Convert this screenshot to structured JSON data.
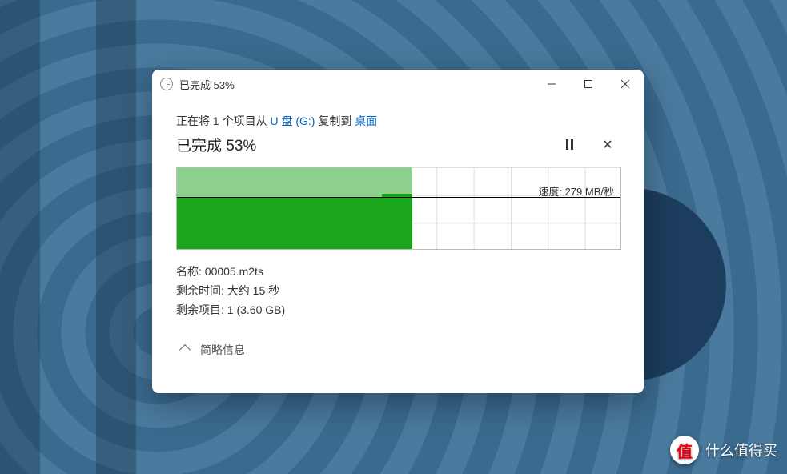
{
  "titlebar": {
    "title": "已完成 53%"
  },
  "copy": {
    "prefix": "正在将 1 个项目从 ",
    "source": "U 盘 (G:)",
    "middle": "复制到 ",
    "destination": "桌面"
  },
  "progress": {
    "title": "已完成 53%"
  },
  "chart_data": {
    "type": "area",
    "x": [
      0,
      10,
      20,
      30,
      40,
      53
    ],
    "values": [
      280,
      278,
      282,
      279,
      281,
      279
    ],
    "ylim": [
      0,
      430
    ],
    "ylabel": "速度 (MB/秒)",
    "progress_percent": 53,
    "current_speed": 279,
    "grid_cols": 12,
    "grid_rows": 3
  },
  "speed": {
    "label": "速度: ",
    "value": "279 MB/秒"
  },
  "details": {
    "name_label": "名称: ",
    "name_value": "00005.m2ts",
    "time_label": "剩余时间: ",
    "time_value": "大约 15 秒",
    "items_label": "剩余项目: ",
    "items_value": "1 (3.60 GB)"
  },
  "toggle": {
    "label": "简略信息"
  },
  "watermark": {
    "badge": "值",
    "text": "什么值得买"
  }
}
